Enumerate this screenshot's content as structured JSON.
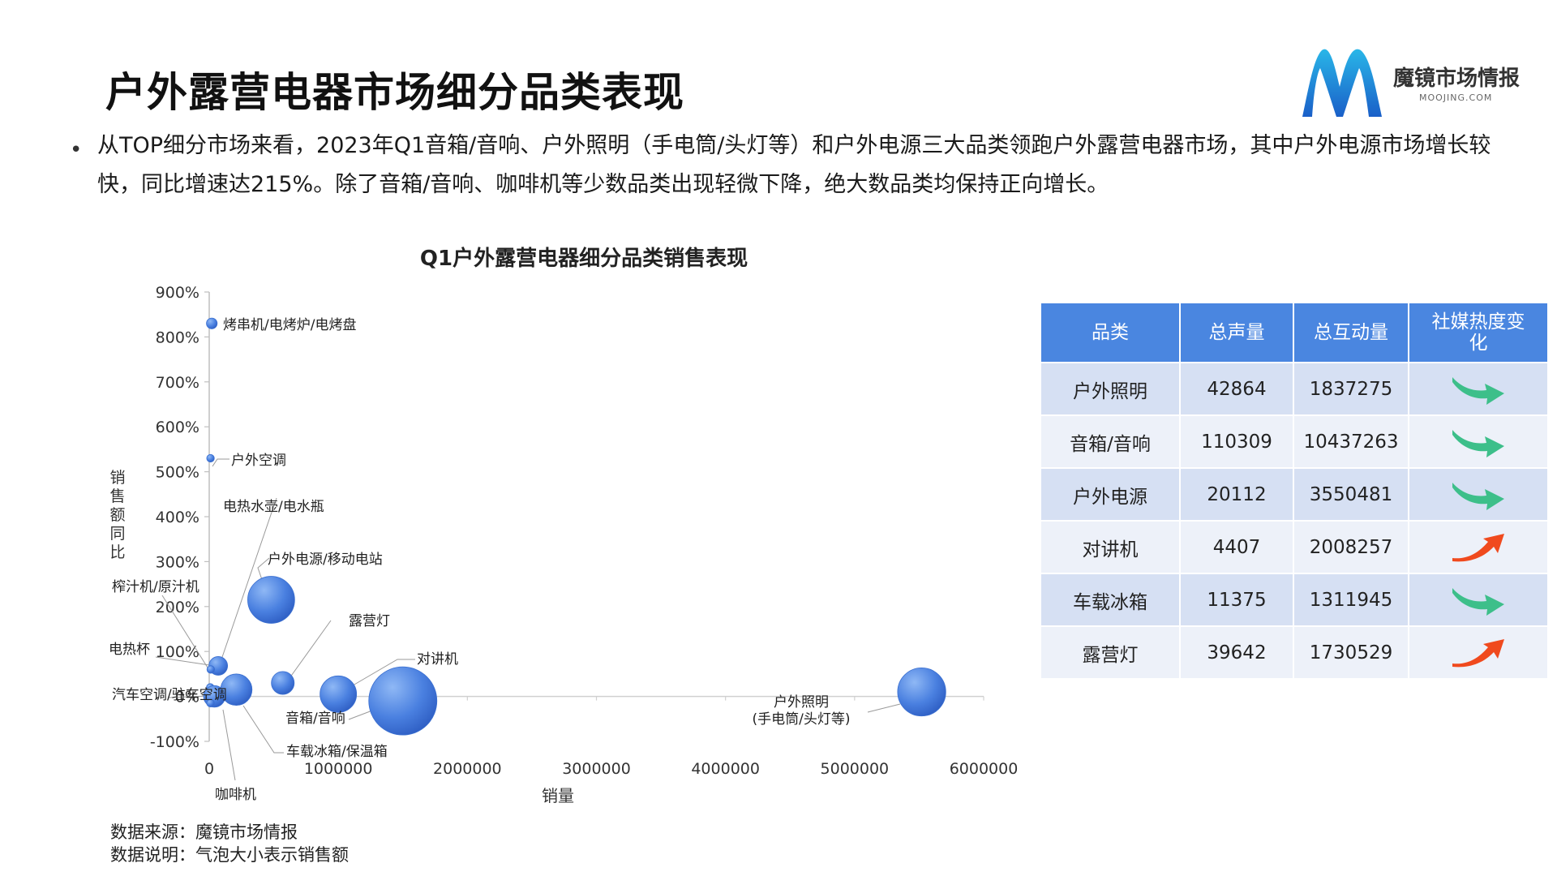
{
  "title": "户外露营电器市场细分品类表现",
  "logo": {
    "name": "魔镜市场情报",
    "sub": "MOOJING.COM"
  },
  "summary": "从TOP细分市场来看，2023年Q1音箱/音响、户外照明（手电筒/头灯等）和户外电源三大品类领跑户外露营电器市场，其中户外电源市场增长较快，同比增速达215%。除了音箱/音响、咖啡机等少数品类出现轻微下降，绝大数品类均保持正向增长。",
  "chart_data": {
    "type": "scatter",
    "title": "Q1户外露营电器细分品类销售表现",
    "xlabel": "销量",
    "ylabel": "销售额同比",
    "xlim": [
      0,
      6000000
    ],
    "ylim": [
      -100,
      900
    ],
    "x_ticks": [
      "0",
      "1000000",
      "2000000",
      "3000000",
      "4000000",
      "5000000",
      "6000000"
    ],
    "y_ticks": [
      "-100%",
      "0%",
      "100%",
      "200%",
      "300%",
      "400%",
      "500%",
      "600%",
      "700%",
      "800%",
      "900%"
    ],
    "grid": false,
    "bubble_size_meaning": "销售额",
    "points": [
      {
        "label": "烤串机/电烤炉/电烤盘",
        "x": 20000,
        "y": 830,
        "size": 2
      },
      {
        "label": "户外空调",
        "x": 10000,
        "y": 530,
        "size": 1
      },
      {
        "label": "电热水壶/电水瓶",
        "x": 70000,
        "y": 68,
        "size": 6
      },
      {
        "label": "户外电源/移动电站",
        "x": 480000,
        "y": 215,
        "size": 38
      },
      {
        "label": "榨汁机/原汁机",
        "x": 12000,
        "y": 60,
        "size": 1
      },
      {
        "label": "露营灯",
        "x": 570000,
        "y": 30,
        "size": 9
      },
      {
        "label": "电热杯",
        "x": 8000,
        "y": 20,
        "size": 1
      },
      {
        "label": "对讲机",
        "x": 1000000,
        "y": 5,
        "size": 23
      },
      {
        "label": "汽车空调/驻车空调",
        "x": 40000,
        "y": 0,
        "size": 8
      },
      {
        "label": "车载冰箱/保温箱",
        "x": 210000,
        "y": 15,
        "size": 17
      },
      {
        "label": "音箱/音响",
        "x": 1500000,
        "y": -10,
        "size": 80
      },
      {
        "label": "咖啡机",
        "x": 10000,
        "y": -15,
        "size": 1
      },
      {
        "label": "户外照明\n(手电筒/头灯等)",
        "x": 5520000,
        "y": 10,
        "size": 40
      }
    ]
  },
  "table": {
    "headers": [
      "品类",
      "总声量",
      "总互动量",
      "社媒热度变化"
    ],
    "rows": [
      {
        "category": "户外照明",
        "voice": "42864",
        "interaction": "1837275",
        "trend": "flat"
      },
      {
        "category": "音箱/音响",
        "voice": "110309",
        "interaction": "10437263",
        "trend": "flat"
      },
      {
        "category": "户外电源",
        "voice": "20112",
        "interaction": "3550481",
        "trend": "flat"
      },
      {
        "category": "对讲机",
        "voice": "4407",
        "interaction": "2008257",
        "trend": "up"
      },
      {
        "category": "车载冰箱",
        "voice": "11375",
        "interaction": "1311945",
        "trend": "flat"
      },
      {
        "category": "露营灯",
        "voice": "39642",
        "interaction": "1730529",
        "trend": "up"
      }
    ],
    "trend_colors": {
      "flat": "#3dbf8a",
      "up": "#f04a1e"
    }
  },
  "source": {
    "line1": "数据来源：魔镜市场情报",
    "line2": "数据说明：气泡大小表示销售额"
  }
}
